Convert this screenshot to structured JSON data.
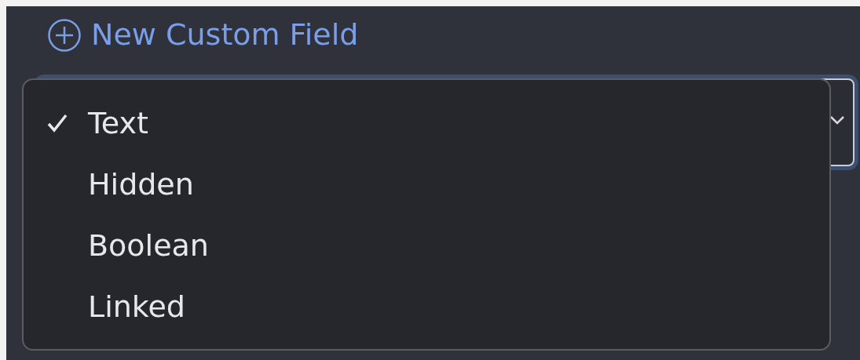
{
  "header_link": {
    "label": "New Custom Field"
  },
  "type_menu": {
    "options": [
      {
        "label": "Text",
        "selected": true
      },
      {
        "label": "Hidden",
        "selected": false
      },
      {
        "label": "Boolean",
        "selected": false
      },
      {
        "label": "Linked",
        "selected": false
      }
    ]
  }
}
